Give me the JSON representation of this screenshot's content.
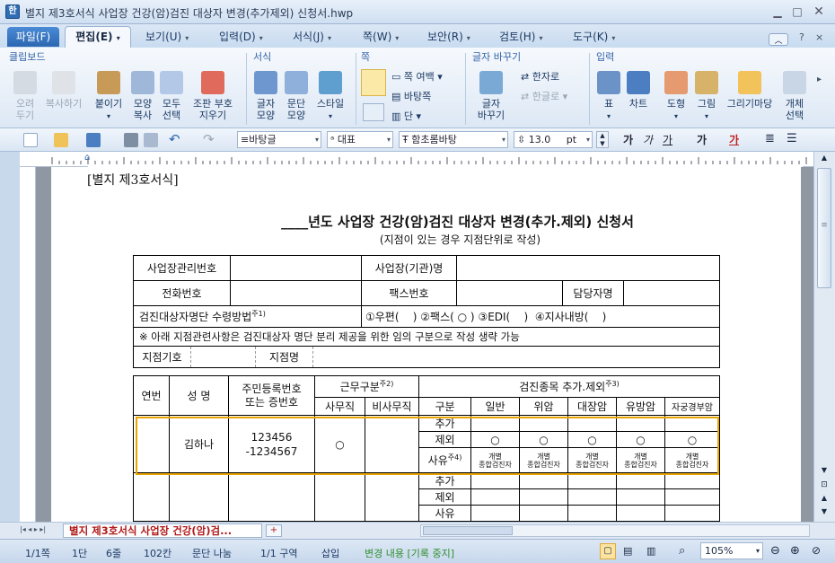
{
  "window": {
    "title": "별지 제3호서식 사업장 건강(암)검진 대상자 변경(추가제외) 신청서.hwp"
  },
  "menu": {
    "file": "파일(F)",
    "items": [
      "편집(E)",
      "보기(U)",
      "입력(D)",
      "서식(J)",
      "쪽(W)",
      "보안(R)",
      "검토(H)",
      "도구(K)"
    ]
  },
  "ribbon": {
    "groups": {
      "clipboard": "클립보드",
      "format": "서식",
      "page": "쪽",
      "replace": "글자 바꾸기",
      "insert": "입력"
    },
    "clipboard": [
      "오려\n두기",
      "복사하기",
      "붙이기",
      "모양\n복사",
      "모두\n선택",
      "조판 부호\n지우기"
    ],
    "format": [
      "글자\n모양",
      "문단\n모양",
      "스타일"
    ],
    "page": {
      "margin": "쪽 여백",
      "bg": "바탕쪽",
      "col": "단"
    },
    "replace": {
      "main": "글자\n바꾸기",
      "hanja": "한자로",
      "hangul": "한글로"
    },
    "insert": [
      "표",
      "차트",
      "도형",
      "그림",
      "그리기마당",
      "개체\n선택"
    ]
  },
  "toolbar": {
    "style": "바탕글",
    "font_lang": "대표",
    "font": "함초롬바탕",
    "size": "13.0",
    "unit": "pt",
    "bold": "가",
    "italic": "가",
    "underline": "가"
  },
  "document": {
    "form_label": "[별지 제3호서식]",
    "title": "____년도 사업장 건강(암)검진 대상자 변경(추가.제외) 신청서",
    "subtitle": "(지점이 있는 경우 지점단위로 작성)",
    "info": {
      "biz_no": "사업장관리번호",
      "biz_name": "사업장(기관)명",
      "phone": "전화번호",
      "fax": "팩스번호",
      "manager": "담당자명",
      "receive": "검진대상자명단 수령방법",
      "receive_sup": "주1)",
      "opt1": "①우편(    )",
      "opt2": "②팩스( ○ )",
      "opt3": "③EDI(    )",
      "opt4": "④지사내방(    )",
      "note": "※ 아래 지점관련사항은 검진대상자 명단 분리 제공을 위한 임의 구분으로 작성 생략 가능",
      "branch_code": "지점기호",
      "branch_name": "지점명"
    },
    "headers": {
      "no": "연번",
      "name": "성 명",
      "rrn": "주민등록번호\n또는 증번호",
      "work": "근무구분",
      "work_sup": "주2)",
      "office": "사무직",
      "nonoffice": "비사무직",
      "items": "검진종목 추가.제외",
      "items_sup": "주3)",
      "kind": "구분",
      "general": "일반",
      "stomach": "위암",
      "colon": "대장암",
      "breast": "유방암",
      "cervix": "자궁경부암"
    },
    "row_labels": {
      "add": "추가",
      "exclude": "제외",
      "reason": "사유",
      "reason_sup": "주4)"
    },
    "row1": {
      "name": "김하나",
      "rrn": "123456\n-1234567",
      "office": "○",
      "marks": [
        "○",
        "○",
        "○",
        "○",
        "○"
      ],
      "reason_text": "개별\n종합검진자"
    }
  },
  "tabs": {
    "doc": "별지 제3호서식 사업장 건강(암)검..."
  },
  "status": {
    "page": "1/1쪽",
    "col": "1단",
    "line": "6줄",
    "char": "102칸",
    "section": "문단 나눔",
    "area": "1/1 구역",
    "mode": "삽입",
    "track": "변경 내용 [기록 중지]",
    "zoom": "105%"
  }
}
